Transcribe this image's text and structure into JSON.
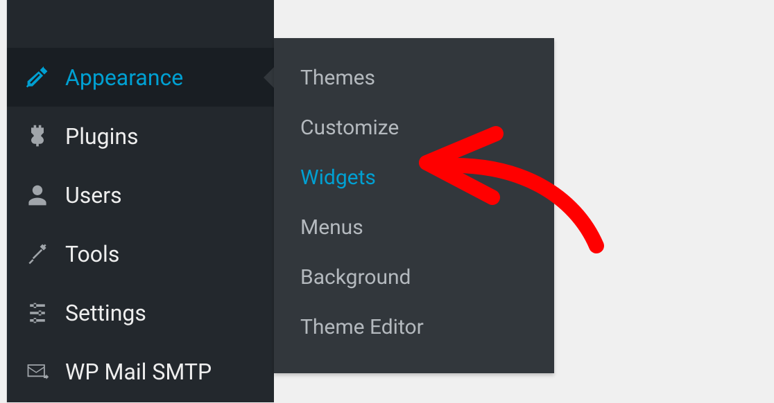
{
  "sidebar": {
    "items": [
      {
        "id": "appearance",
        "label": "Appearance",
        "active": true
      },
      {
        "id": "plugins",
        "label": "Plugins"
      },
      {
        "id": "users",
        "label": "Users"
      },
      {
        "id": "tools",
        "label": "Tools"
      },
      {
        "id": "settings",
        "label": "Settings"
      },
      {
        "id": "wp-mail-smtp",
        "label": "WP Mail SMTP"
      }
    ]
  },
  "submenu": {
    "items": [
      {
        "id": "themes",
        "label": "Themes"
      },
      {
        "id": "customize",
        "label": "Customize"
      },
      {
        "id": "widgets",
        "label": "Widgets",
        "current": true
      },
      {
        "id": "menus",
        "label": "Menus"
      },
      {
        "id": "background",
        "label": "Background"
      },
      {
        "id": "theme-editor",
        "label": "Theme Editor"
      }
    ]
  },
  "colors": {
    "accent": "#00a0d2",
    "annotation": "#ff0000"
  }
}
